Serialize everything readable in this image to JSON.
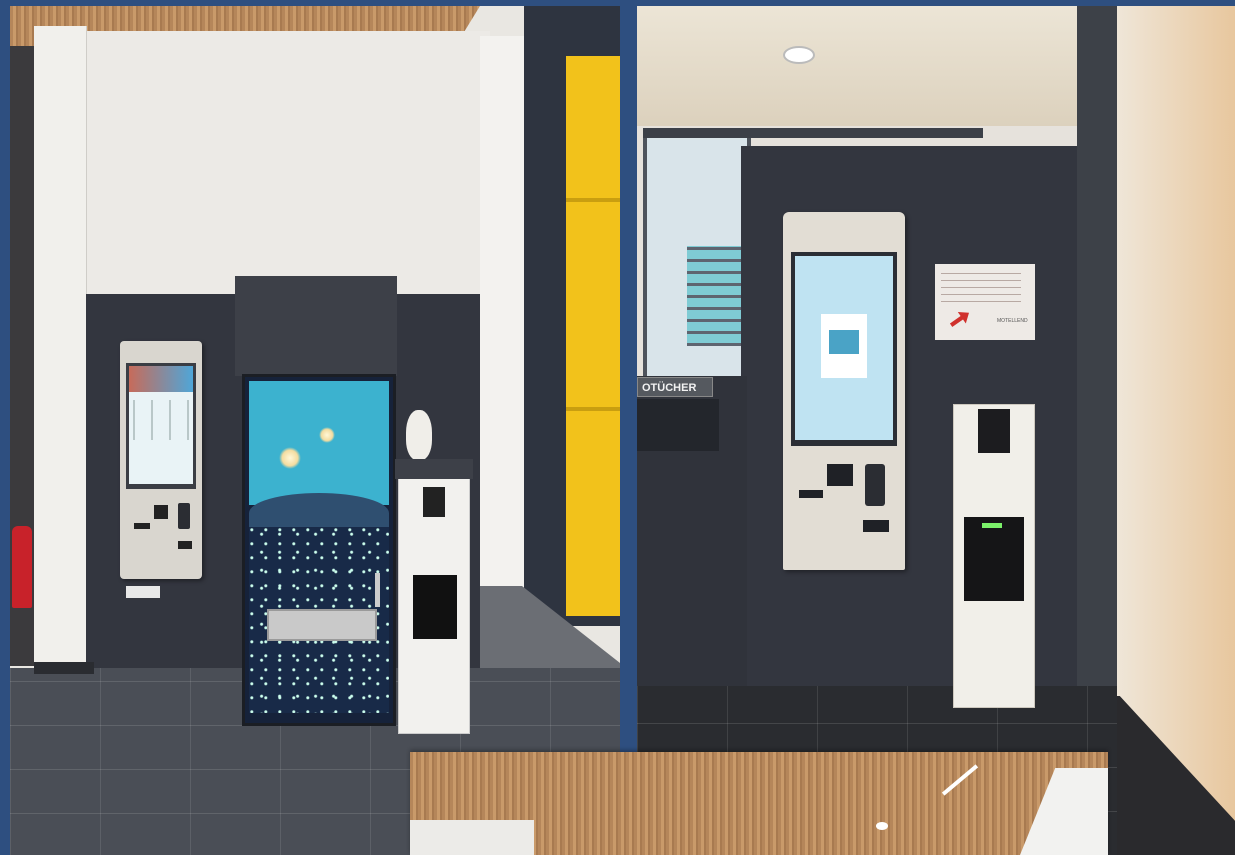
{
  "collage": {
    "description_hidden": true
  },
  "right_photo": {
    "wall_sign_label": "OTÜCHER",
    "notice_brand": "MOTELLEND"
  },
  "colors": {
    "backdrop": "#2e4f80",
    "wall_dark": "#33363f",
    "kiosk_body": "#d8d4cc",
    "window_yellow": "#f2c21b",
    "screen_blue": "#bfe3f2"
  }
}
